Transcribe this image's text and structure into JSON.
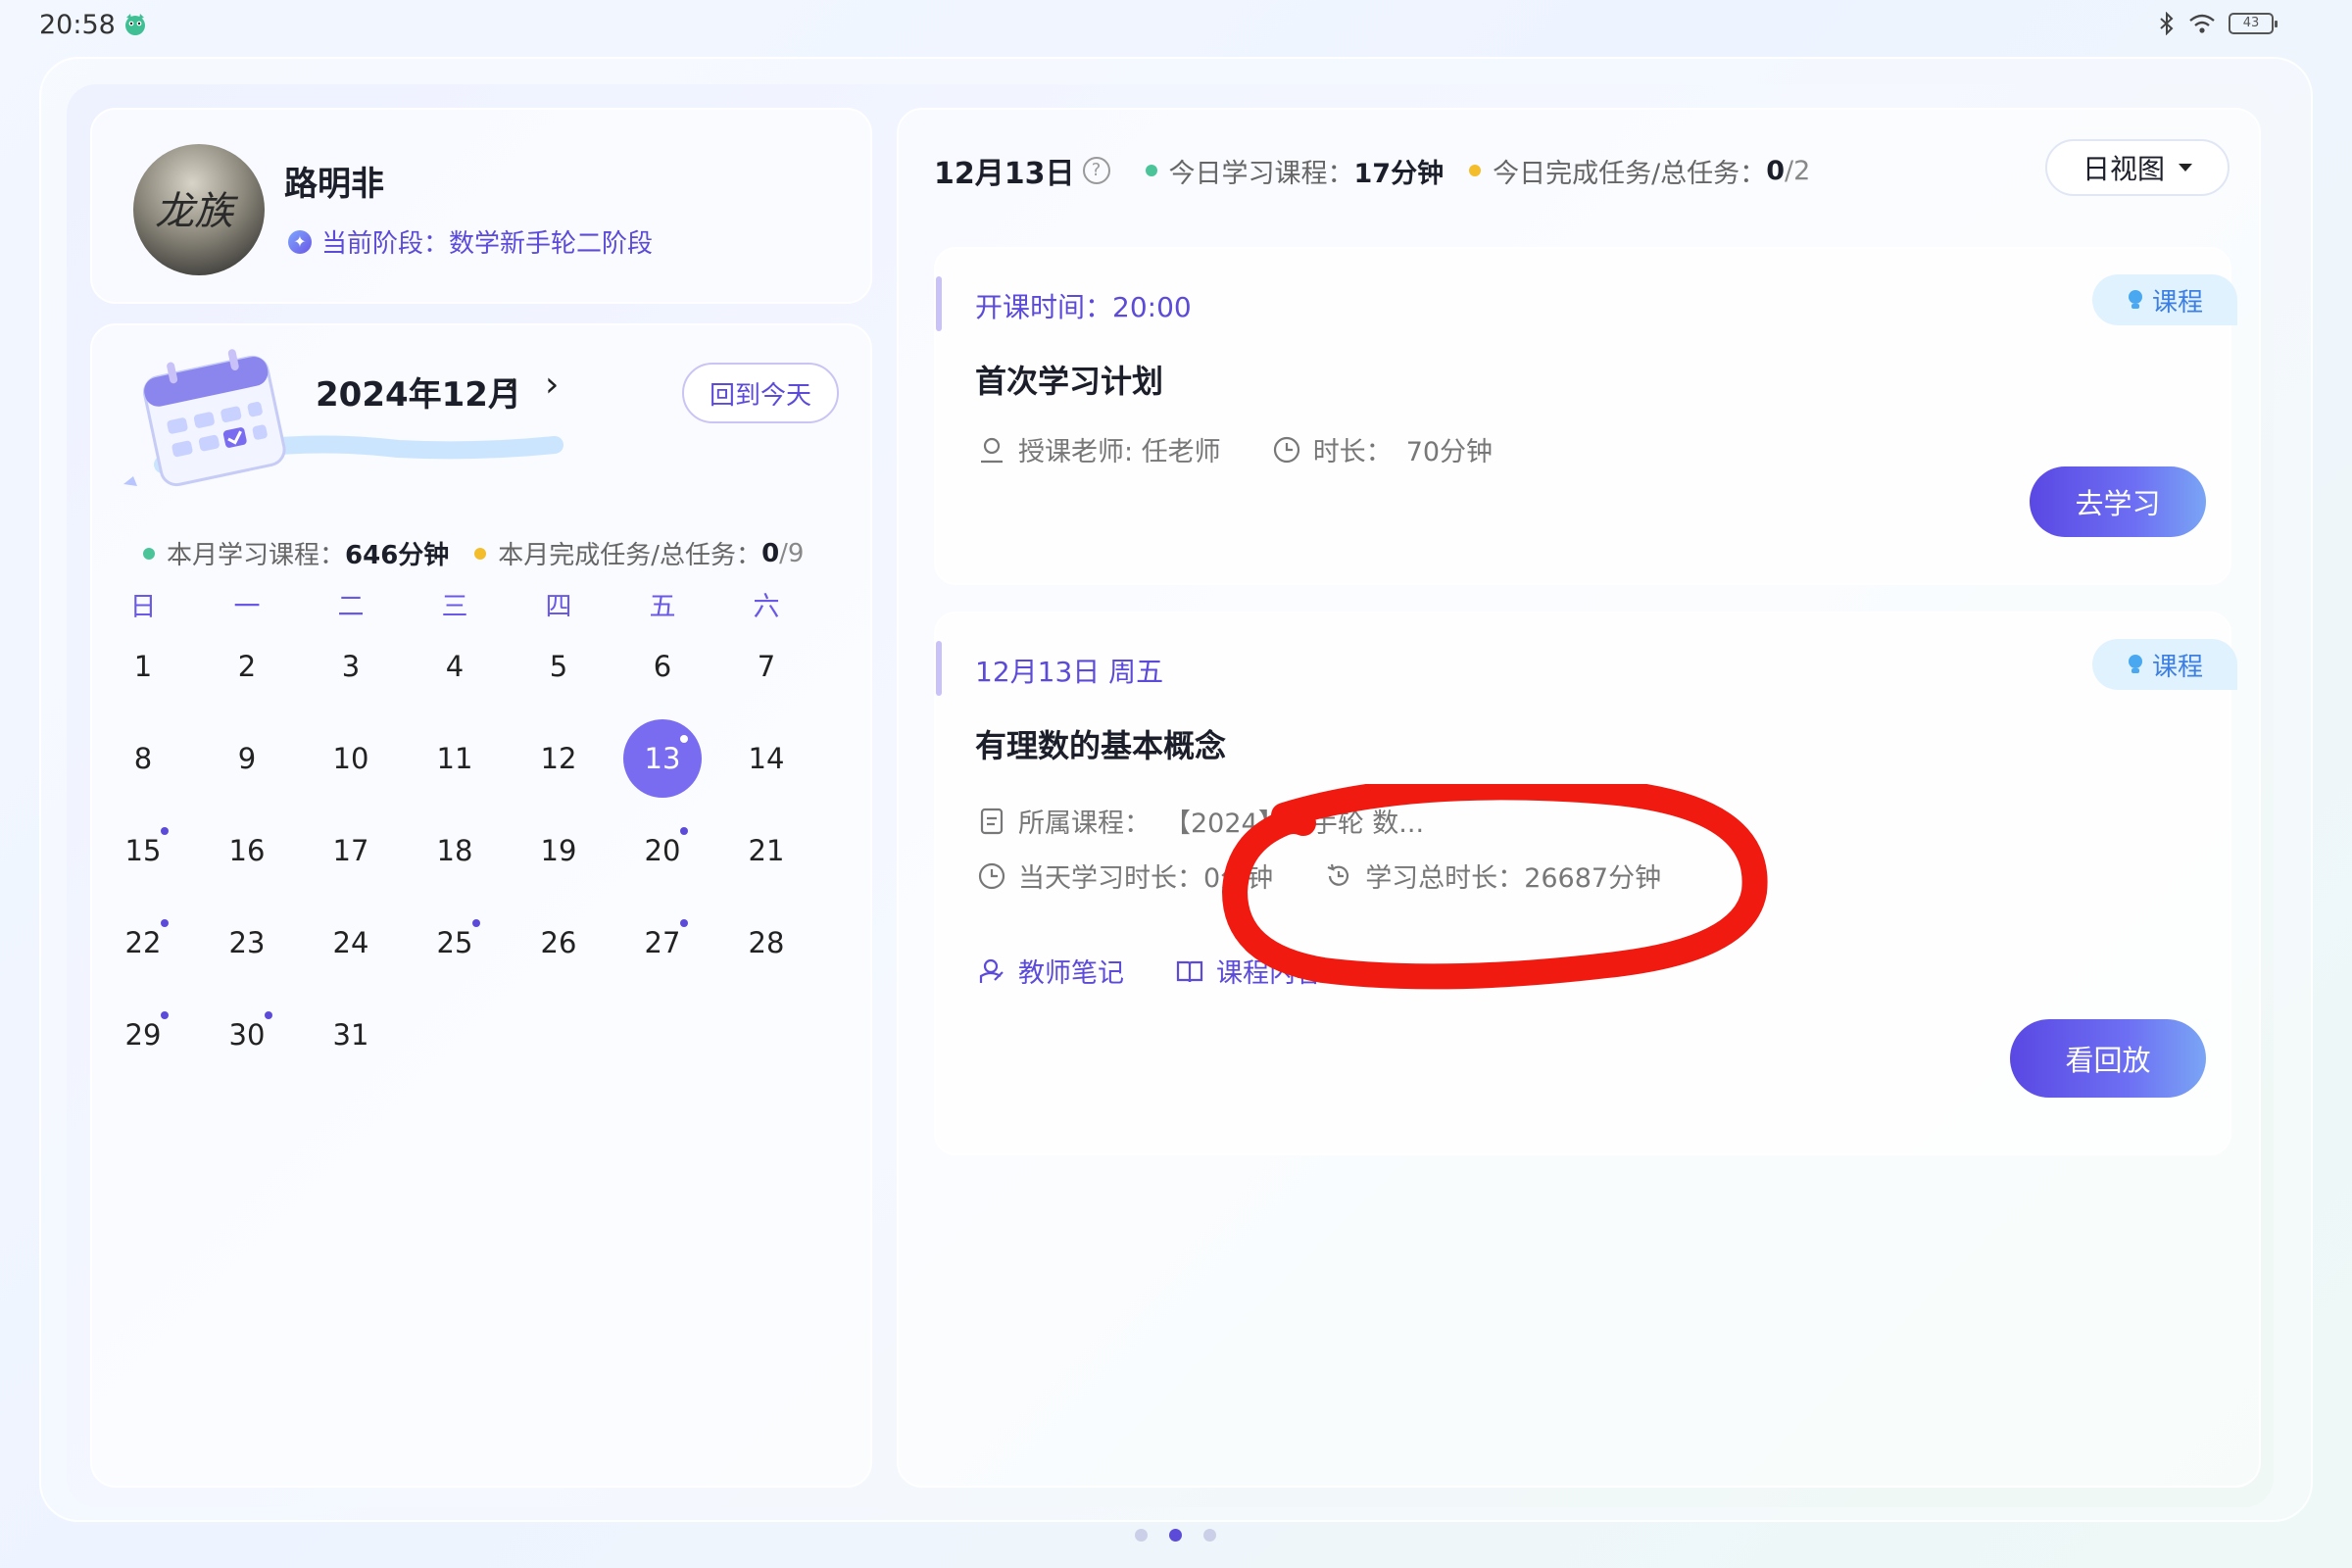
{
  "status_bar": {
    "time": "20:58",
    "battery_level": "43"
  },
  "profile": {
    "avatar_text": "龙族",
    "name": "路明非",
    "stage_label": "当前阶段：",
    "stage_value": "数学新手轮二阶段"
  },
  "calendar": {
    "month_title": "2024年12月",
    "prev_label": "‹",
    "next_label": "›",
    "today_button": "回到今天",
    "stats": {
      "courses_label": "本月学习课程：",
      "courses_value": "646分钟",
      "tasks_label": "本月完成任务/总任务：",
      "tasks_done": "0",
      "tasks_total": "/9"
    },
    "weekdays": [
      "日",
      "一",
      "二",
      "三",
      "四",
      "五",
      "六"
    ],
    "selected_day": 13,
    "marked_days": [
      13,
      15,
      20,
      22,
      25,
      27,
      29,
      30
    ],
    "first_weekday_offset": 0,
    "days_in_month": 31
  },
  "day_view": {
    "date": "12月13日",
    "help_icon": "?",
    "courses_label": "今日学习课程：",
    "courses_value": "17分钟",
    "tasks_label": "今日完成任务/总任务：",
    "tasks_done": "0",
    "tasks_total": "/2",
    "view_selector": "日视图"
  },
  "cards": [
    {
      "tag": "课程",
      "time_line": "开课时间：20:00",
      "title": "首次学习计划",
      "teacher": "授课老师: 任老师",
      "duration_label": "时长：",
      "duration_value": "70分钟",
      "action": "去学习"
    },
    {
      "tag": "课程",
      "time_line": "12月13日 周五",
      "title": "有理数的基本概念",
      "course_label": "所属课程：",
      "course_value": "【2024】新手轮 数...",
      "day_duration_label": "当天学习时长：",
      "day_duration_value": "0分钟",
      "total_duration_label": "学习总时长：",
      "total_duration_value": "26687分钟",
      "link_notes": "教师笔记",
      "link_content": "课程内容",
      "action": "看回放"
    }
  ],
  "pager": {
    "pages": 3,
    "active": 1
  },
  "colors": {
    "accent": "#5b4bd8",
    "selected_day": "#7a6cf0",
    "green_dot": "#4cc49a",
    "yellow_dot": "#f3bd2c",
    "tag_bg": "#e1f2ff",
    "annotation_red": "#f01a10"
  }
}
